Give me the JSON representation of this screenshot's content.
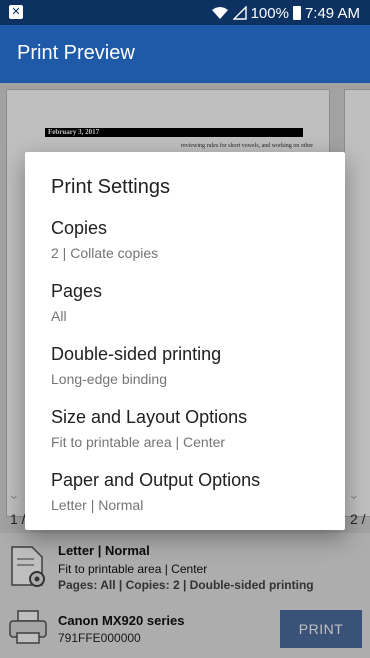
{
  "status_bar": {
    "battery": "100%",
    "time": "7:49 AM"
  },
  "app_bar": {
    "title": "Print Preview"
  },
  "preview": {
    "doc_date": "February 3, 2017",
    "doc_text": "reviewing rules for short vowels, and working on other phonetic skills.",
    "page_left": "1 /",
    "page_right": "2 /"
  },
  "dialog": {
    "title": "Print Settings",
    "options": [
      {
        "title": "Copies",
        "subtitle": "2 | Collate copies"
      },
      {
        "title": "Pages",
        "subtitle": "All"
      },
      {
        "title": "Double-sided printing",
        "subtitle": "Long-edge binding"
      },
      {
        "title": "Size and Layout Options",
        "subtitle": "Fit to printable area | Center"
      },
      {
        "title": "Paper and Output Options",
        "subtitle": "Letter | Normal"
      }
    ]
  },
  "summary": {
    "line1": "Letter | Normal",
    "line2": "Fit to printable area | Center",
    "line3": "Pages: All | Copies: 2 | Double-sided printing"
  },
  "printer": {
    "name": "Canon MX920 series",
    "id": "791FFE000000",
    "print_label": "PRINT"
  }
}
